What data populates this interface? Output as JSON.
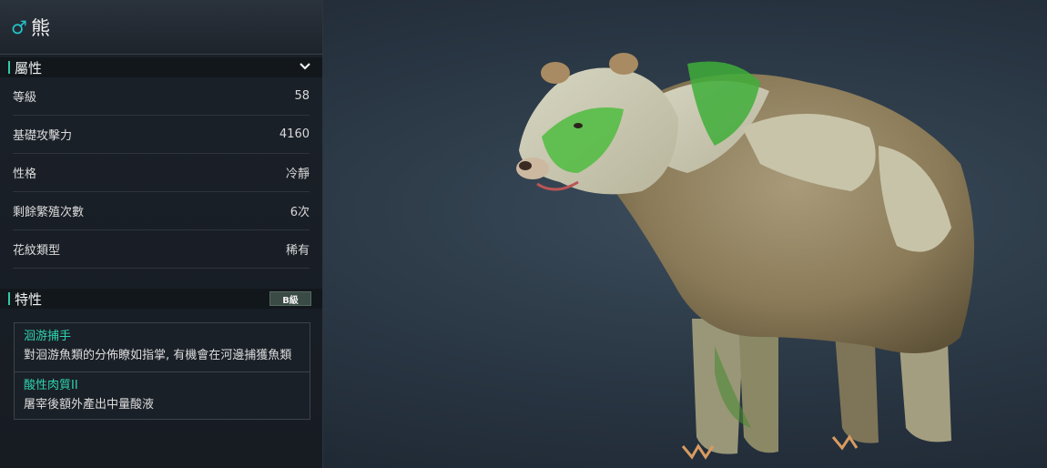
{
  "creature": {
    "gender_symbol": "♂",
    "name": "熊"
  },
  "attributes": {
    "title": "屬性",
    "rows": [
      {
        "label": "等級",
        "value": "58"
      },
      {
        "label": "基礎攻擊力",
        "value": "4160"
      },
      {
        "label": "性格",
        "value": "冷靜"
      },
      {
        "label": "剩餘繁殖次數",
        "value": "6次"
      },
      {
        "label": "花紋類型",
        "value": "稀有"
      }
    ]
  },
  "traits": {
    "title": "特性",
    "grade": "B級",
    "items": [
      {
        "name": "洄游捕手",
        "desc": "對洄游魚類的分佈瞭如指掌, 有機會在河邊捕獲魚類"
      },
      {
        "name": "酸性肉質II",
        "desc": "屠宰後額外產出中量酸液"
      }
    ]
  },
  "colors": {
    "accent": "#2fd3b0",
    "gender": "#23c4c8",
    "panel_bg": "#1b2129"
  }
}
